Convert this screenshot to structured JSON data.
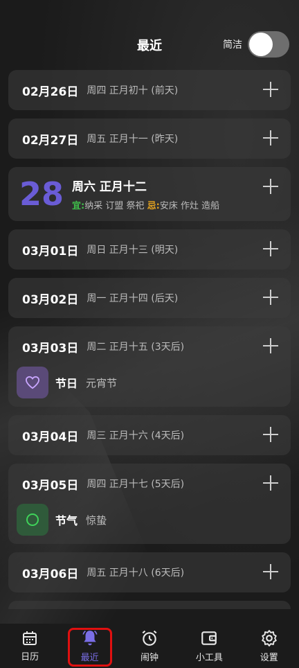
{
  "header": {
    "title": "最近",
    "switch_label": "简洁"
  },
  "days": [
    {
      "date": "02月26日",
      "sub": "周四 正月初十 (前天)"
    },
    {
      "date": "02月27日",
      "sub": "周五 正月十一 (昨天)"
    }
  ],
  "today": {
    "day": "28",
    "line1": "周六 正月十二",
    "yi_label": "宜:",
    "yi_text": "纳采 订盟 祭祀",
    "ji_label": "忌:",
    "ji_text": "安床 作灶 造船"
  },
  "days2": [
    {
      "date": "03月01日",
      "sub": "周日 正月十三 (明天)"
    },
    {
      "date": "03月02日",
      "sub": "周一 正月十四 (后天)"
    }
  ],
  "day_0303": {
    "date": "03月03日",
    "sub": "周二 正月十五 (3天后)",
    "event_type": "节日",
    "event_name": "元宵节"
  },
  "day_0304": {
    "date": "03月04日",
    "sub": "周三 正月十六 (4天后)"
  },
  "day_0305": {
    "date": "03月05日",
    "sub": "周四 正月十七 (5天后)",
    "event_type": "节气",
    "event_name": "惊蛰"
  },
  "day_0306": {
    "date": "03月06日",
    "sub": "周五 正月十八 (6天后)"
  },
  "nav": {
    "calendar": "日历",
    "recent": "最近",
    "alarm": "闹钟",
    "tools": "小工具",
    "settings": "设置"
  },
  "colors": {
    "accent": "#6a5cd6",
    "yi": "#3fbf4a",
    "ji": "#e0a020"
  }
}
